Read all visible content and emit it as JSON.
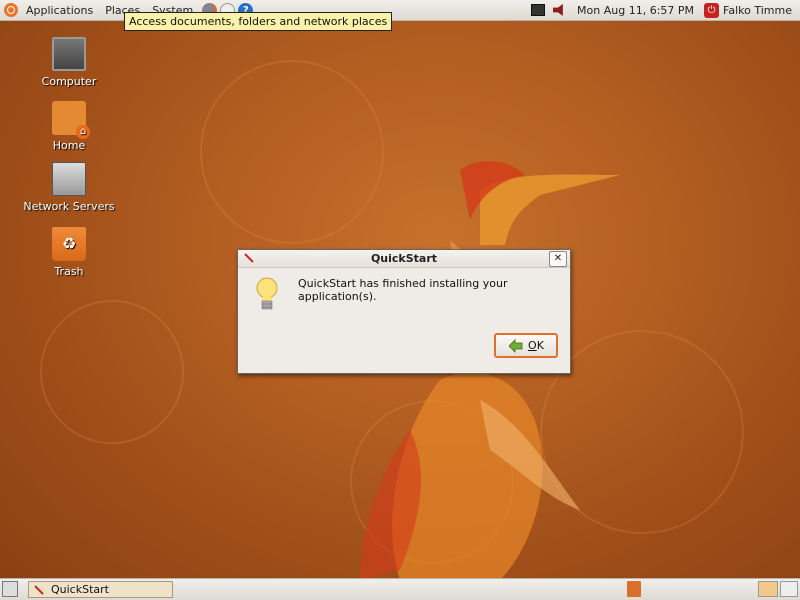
{
  "top_panel": {
    "menu": [
      "Applications",
      "Places",
      "System"
    ],
    "clock": "Mon Aug 11,  6:57 PM",
    "user": "Falko Timme",
    "launchers": [
      "firefox-icon",
      "mail-icon",
      "help-icon"
    ],
    "help_glyph": "?"
  },
  "tooltip": "Access documents, folders and network places",
  "desktop_icons": [
    {
      "label": "Computer",
      "icon": "computer-icon"
    },
    {
      "label": "Home",
      "icon": "home-folder-icon"
    },
    {
      "label": "Network Servers",
      "icon": "network-servers-icon"
    },
    {
      "label": "Trash",
      "icon": "trash-icon"
    }
  ],
  "dialog": {
    "title": "QuickStart",
    "message": "QuickStart has finished installing your application(s).",
    "ok_label_underlined": "O",
    "ok_label_rest": "K",
    "close_glyph": "✕"
  },
  "taskbar": {
    "tasks": [
      {
        "label": "QuickStart"
      }
    ]
  },
  "colors": {
    "accent": "#e07030",
    "panel": "#dedad3",
    "tooltip": "#f8f3a8",
    "desktop": "#b45f22"
  }
}
